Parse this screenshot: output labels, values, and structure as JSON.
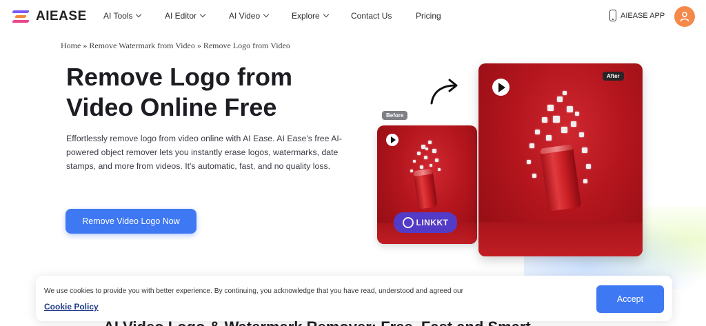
{
  "header": {
    "logo_text": "AIEASE",
    "nav": [
      {
        "label": "AI Tools",
        "has_dropdown": true
      },
      {
        "label": "AI Editor",
        "has_dropdown": true
      },
      {
        "label": "AI Video",
        "has_dropdown": true
      },
      {
        "label": "Explore",
        "has_dropdown": true
      },
      {
        "label": "Contact Us",
        "has_dropdown": false
      },
      {
        "label": "Pricing",
        "has_dropdown": false
      }
    ],
    "app_label": "AIEASE APP",
    "app_icon": "phone-icon",
    "avatar_icon": "user-icon"
  },
  "breadcrumb": {
    "items": [
      "Home",
      "Remove Watermark from Video",
      "Remove Logo from Video"
    ],
    "separator": "»"
  },
  "hero": {
    "title_line1": "Remove Logo from",
    "title_line2": "Video Online Free",
    "description": "Effortlessly remove logo from video online with AI Ease. AI Ease's free AI-powered object remover lets you instantly erase logos, watermarks, date stamps, and more from videos. It's automatic, fast, and no quality loss.",
    "cta_label": "Remove Video Logo Now"
  },
  "visual": {
    "before_label": "Before",
    "after_label": "After",
    "watermark_text": "LINKKT",
    "play_icon": "play-icon",
    "arrow_icon": "curved-arrow-icon"
  },
  "cookie": {
    "message": "We use cookies to provide you with better experience. By continuing, you acknowledge that you have read, understood and agreed our",
    "policy_link": "Cookie Policy",
    "accept_label": "Accept"
  },
  "next_section": {
    "heading_peek": "AI Video Logo & Watermark Remover: Free, Fast and Smart"
  },
  "colors": {
    "primary": "#3f78f3",
    "avatar": "#f5894a",
    "card_red": "#b3151d",
    "watermark": "#4b3fd6"
  }
}
